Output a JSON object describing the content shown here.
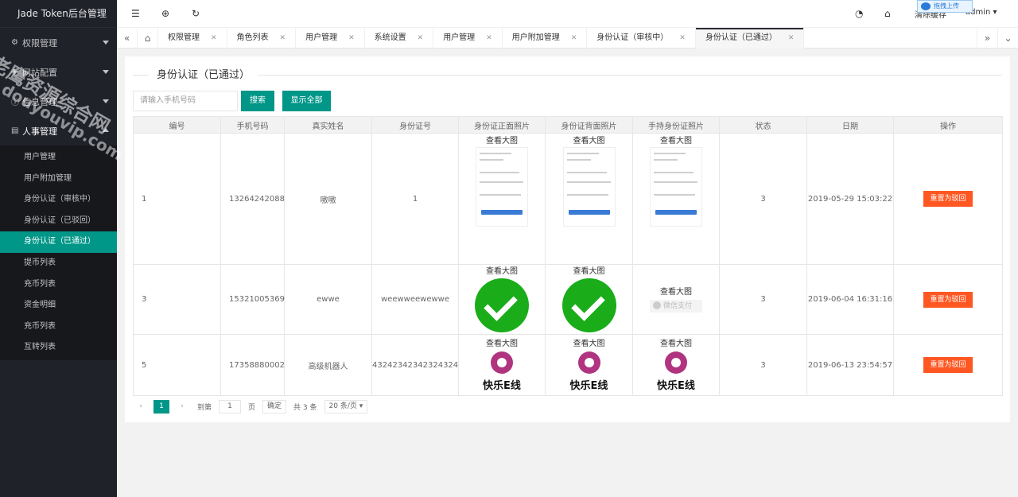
{
  "app": {
    "title": "Jade Token后台管理"
  },
  "sidebar": {
    "groups": [
      {
        "label": "权限管理",
        "icon": "settings-icon"
      },
      {
        "label": "网站配置",
        "icon": "cube-icon"
      },
      {
        "label": "信息管理",
        "icon": "info-icon"
      },
      {
        "label": "人事管理",
        "icon": "document-icon"
      }
    ],
    "items": [
      {
        "label": "用户管理"
      },
      {
        "label": "用户附加管理"
      },
      {
        "label": "身份认证（审核中）"
      },
      {
        "label": "身份认证（已驳回）"
      },
      {
        "label": "身份认证（已通过）"
      },
      {
        "label": "提币列表"
      },
      {
        "label": "充币列表"
      },
      {
        "label": "资金明细"
      },
      {
        "label": "充币列表"
      },
      {
        "label": "互转列表"
      }
    ]
  },
  "header": {
    "clear_cache": "清除缓存",
    "user": "admin",
    "upload_badge": "拖拽上传"
  },
  "tabs": [
    {
      "label": "权限管理"
    },
    {
      "label": "角色列表"
    },
    {
      "label": "用户管理"
    },
    {
      "label": "系统设置"
    },
    {
      "label": "用户管理"
    },
    {
      "label": "用户附加管理"
    },
    {
      "label": "身份认证（审核中）"
    },
    {
      "label": "身份认证（已通过）"
    }
  ],
  "page": {
    "title": "身份认证（已通过）",
    "search_placeholder": "请输入手机号码",
    "search_button": "搜索",
    "show_all_button": "显示全部"
  },
  "table": {
    "headers": [
      "编号",
      "手机号码",
      "真实姓名",
      "身份证号",
      "身份证正面照片",
      "身份证背面照片",
      "手持身份证照片",
      "状态",
      "日期",
      "操作"
    ],
    "view_large": "查看大图",
    "action_label": "重置为驳回",
    "wechat_pay": "微信支付",
    "kl_logo_text": "快乐E线",
    "rows": [
      {
        "id": "1",
        "phone": "13264242088",
        "name": "嗷嗷",
        "idno": "1",
        "status": "3",
        "date": "2019-05-29 15:03:22"
      },
      {
        "id": "3",
        "phone": "15321005369",
        "name": "ewwe",
        "idno": "weewweewewwe",
        "status": "3",
        "date": "2019-06-04 16:31:16"
      },
      {
        "id": "5",
        "phone": "17358880002",
        "name": "高级机器人",
        "idno": "43242342342324324",
        "status": "3",
        "date": "2019-06-13 23:54:57"
      }
    ]
  },
  "pager": {
    "current": "1",
    "goto_label": "到第",
    "page_value": "1",
    "page_unit": "页",
    "confirm": "确定",
    "total": "共 3 条",
    "per_page": "20 条/页"
  },
  "watermark": {
    "line1": "老鹰资源综合网",
    "line2": "douyouvip.com"
  }
}
